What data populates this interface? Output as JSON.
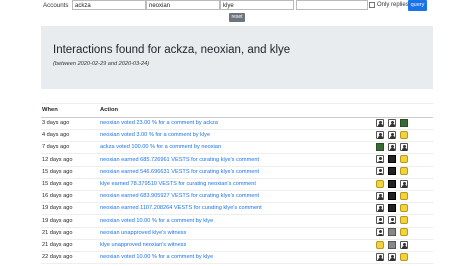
{
  "search": {
    "accounts_label": "Accounts",
    "account1": "ackza",
    "account2": "neoxian",
    "account3": "klye",
    "account4": "",
    "only_replies_label": "Only replies",
    "query_label": "query",
    "reset_label": "reset"
  },
  "header": {
    "title": "Interactions found for ackza, neoxian, and klye",
    "subtitle": "(between 2020-02-29 and 2020-03-24)"
  },
  "table": {
    "col_when": "When",
    "col_action": "Action",
    "rows": [
      {
        "when": "3 days ago",
        "action": "neoxian voted 23.00 % for a comment by ackza",
        "icons": [
          "user-icon",
          "avatar-user-icon",
          "avatar-green-icon"
        ]
      },
      {
        "when": "4 days ago",
        "action": "neoxian voted 3.00 % for a comment by klye",
        "icons": [
          "user-icon",
          "avatar-user-icon",
          "avatar-yellow-icon"
        ]
      },
      {
        "when": "7 days ago",
        "action": "ackza voted 100.00 % for a comment by neoxian",
        "icons": [
          "avatar-green-icon",
          "user-icon",
          "avatar-user-icon"
        ]
      },
      {
        "when": "12 days ago",
        "action": "neoxian earned 685.726961 VESTS for curating klye's comment",
        "icons": [
          "user-icon",
          "avatar-dark-icon",
          "avatar-yellow-icon"
        ]
      },
      {
        "when": "15 days ago",
        "action": "neoxian earned 546.696631 VESTS for curating klye's comment",
        "icons": [
          "user-icon",
          "avatar-dark-icon",
          "avatar-yellow-icon"
        ]
      },
      {
        "when": "15 days ago",
        "action": "klye earned 78.379510 VESTS for curating neoxian's comment",
        "icons": [
          "avatar-yellow-icon",
          "avatar-dark-icon",
          "avatar-user-icon"
        ]
      },
      {
        "when": "16 days ago",
        "action": "neoxian earned 683.905927 VESTS for curating klye's comment",
        "icons": [
          "user-icon",
          "avatar-dark-icon",
          "avatar-yellow-icon"
        ]
      },
      {
        "when": "19 days ago",
        "action": "neoxian earned 1107.208264 VESTS for curating klye's comment",
        "icons": [
          "user-icon",
          "avatar-dark-icon",
          "avatar-yellow-icon"
        ]
      },
      {
        "when": "19 days ago",
        "action": "neoxian voted 10.00 % for a comment by klye",
        "icons": [
          "user-icon",
          "avatar-user-icon",
          "avatar-yellow-icon"
        ]
      },
      {
        "when": "21 days ago",
        "action": "neoxian unapproved klye's witness",
        "icons": [
          "user-icon",
          "avatar-gray-icon",
          "avatar-yellow-icon"
        ]
      },
      {
        "when": "21 days ago",
        "action": "klye unapproved neoxian's witness",
        "icons": [
          "avatar-yellow-icon",
          "avatar-gray-icon",
          "avatar-user-icon"
        ]
      },
      {
        "when": "22 days ago",
        "action": "neoxian voted 10.00 % for a comment by klye",
        "icons": [
          "user-icon",
          "avatar-user-icon",
          "avatar-yellow-icon"
        ]
      }
    ]
  }
}
